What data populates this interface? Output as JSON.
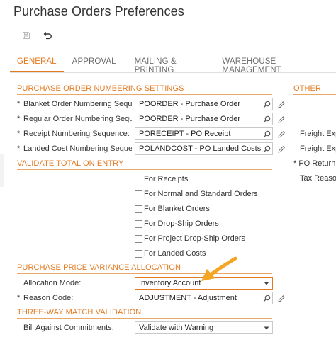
{
  "page": {
    "title": "Purchase Orders Preferences"
  },
  "toolbar": {
    "save_icon": "save-icon",
    "undo_icon": "undo-icon"
  },
  "tabs": [
    {
      "label": "GENERAL",
      "active": true
    },
    {
      "label": "APPROVAL",
      "active": false
    },
    {
      "label": "MAILING & PRINTING",
      "active": false
    },
    {
      "label": "WAREHOUSE MANAGEMENT",
      "active": false
    }
  ],
  "sections": {
    "numbering": "PURCHASE ORDER NUMBERING SETTINGS",
    "other": "OTHER",
    "validate": "VALIDATE TOTAL ON ENTRY",
    "ppv": "PURCHASE PRICE VARIANCE ALLOCATION",
    "threeway": "THREE-WAY MATCH VALIDATION"
  },
  "numbering_fields": [
    {
      "required": "*",
      "label": "Blanket Order Numbering Sequ...",
      "value": "POORDER - Purchase Order"
    },
    {
      "required": "*",
      "label": "Regular Order Numbering Sequ...",
      "value": "POORDER - Purchase Order"
    },
    {
      "required": "*",
      "label": "Receipt Numbering Sequence:",
      "value": "PORECEIPT - PO Receipt"
    },
    {
      "required": "*",
      "label": "Landed Cost Numbering Seque...",
      "value": "POLANDCOST - PO Landed Costs"
    }
  ],
  "validate_checkboxes": [
    {
      "label": "For Receipts",
      "checked": false
    },
    {
      "label": "For Normal and Standard Orders",
      "checked": false
    },
    {
      "label": "For Blanket Orders",
      "checked": false
    },
    {
      "label": "For Drop-Ship Orders",
      "checked": false
    },
    {
      "label": "For Project Drop-Ship Orders",
      "checked": false
    },
    {
      "label": "For Landed Costs",
      "checked": false
    }
  ],
  "ppv": {
    "allocation_label": "Allocation Mode:",
    "allocation_value": "Inventory Account",
    "reason_required": "*",
    "reason_label": "Reason Code:",
    "reason_value": "ADJUSTMENT - Adjustment"
  },
  "threeway": {
    "bill_label": "Bill Against Commitments:",
    "bill_value": "Validate with Warning"
  },
  "other_fields": [
    {
      "required": "",
      "label": "Freight Exp"
    },
    {
      "required": "",
      "label": "Freight Exp"
    },
    {
      "required": "*",
      "label": "PO Return"
    },
    {
      "required": "",
      "label": "Tax Reason"
    }
  ],
  "colors": {
    "accent": "#e37a22",
    "arrow": "#f2a623",
    "section_line": "#e9a768"
  }
}
